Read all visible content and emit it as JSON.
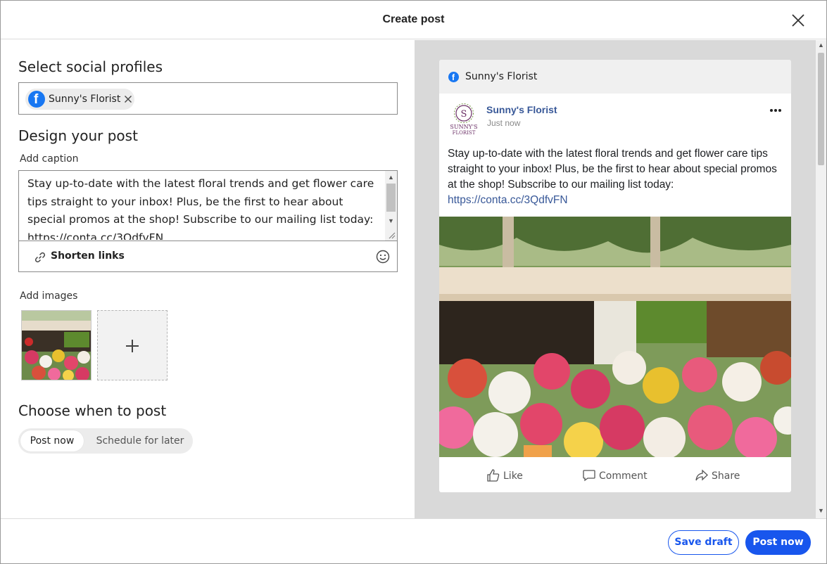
{
  "header": {
    "title": "Create post"
  },
  "profiles": {
    "section_title": "Select social profiles",
    "selected": [
      {
        "network": "facebook",
        "name": "Sunny's Florist"
      }
    ]
  },
  "design": {
    "section_title": "Design your post",
    "caption_label": "Add caption",
    "caption_text": "Stay up-to-date with the latest floral trends and get flower care tips straight to your inbox! Plus, be the first to hear about special promos at the shop! Subscribe to our mailing list today: https://conta.cc/3QdfvFN",
    "shorten_links_label": "Shorten links",
    "images_label": "Add images"
  },
  "schedule": {
    "section_title": "Choose when to post",
    "options": [
      "Post now",
      "Schedule for later"
    ],
    "selected": "Post now"
  },
  "preview": {
    "network": "facebook",
    "top_name": "Sunny's Florist",
    "page_name": "Sunny's Florist",
    "avatar_text": "SUNNY'S FLORIST",
    "timestamp": "Just now",
    "text": "Stay up-to-date with the latest floral trends and get flower care tips straight to your inbox! Plus, be the first to hear about special promos at the shop! Subscribe to our mailing list today:",
    "link": "https://conta.cc/3QdfvFN",
    "actions": [
      "Like",
      "Comment",
      "Share"
    ]
  },
  "footer": {
    "save_draft_label": "Save draft",
    "post_now_label": "Post now"
  },
  "colors": {
    "brand_blue": "#1856ed",
    "facebook_blue": "#1877f2",
    "fb_link": "#385898"
  }
}
